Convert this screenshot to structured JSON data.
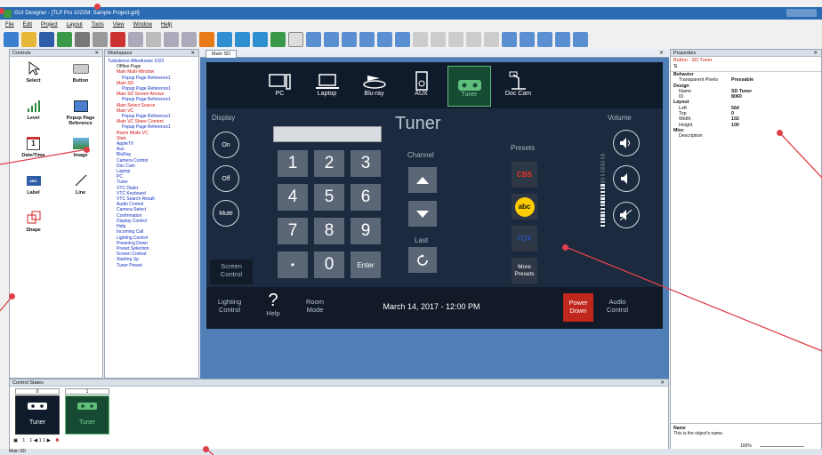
{
  "app": {
    "title": "GUI Designer - [TLP Pro 1022M: Sample Project.gdl]"
  },
  "menu": [
    "File",
    "Edit",
    "Project",
    "Layout",
    "Tools",
    "View",
    "Window",
    "Help"
  ],
  "controls_panel": {
    "title": "Controls",
    "items": [
      {
        "label": "Select",
        "icon": "cursor-icon"
      },
      {
        "label": "Button",
        "icon": "button-icon"
      },
      {
        "label": "Level",
        "icon": "level-icon"
      },
      {
        "label": "Popup Page Reference",
        "icon": "popup-page-icon"
      },
      {
        "label": "Date/Time",
        "icon": "calendar-icon"
      },
      {
        "label": "Image",
        "icon": "image-icon"
      },
      {
        "label": "Label",
        "icon": "label-icon"
      },
      {
        "label": "Line",
        "icon": "line-icon"
      },
      {
        "label": "Shape",
        "icon": "shape-icon"
      }
    ]
  },
  "workspace_panel": {
    "title": "Workspace",
    "tree": [
      {
        "text": "Turbulence Afterdusive 1022",
        "c": "blue"
      },
      {
        "text": "Offline Page",
        "c": "k"
      },
      {
        "text": "Main Multi-Window",
        "c": "red"
      },
      {
        "text": "Popup Page Reference1",
        "c": "blue"
      },
      {
        "text": "Main SD",
        "c": "red"
      },
      {
        "text": "Popup Page Reference1",
        "c": "blue"
      },
      {
        "text": "Main SD Screen Arrows",
        "c": "red"
      },
      {
        "text": "Popup Page Reference1",
        "c": "blue"
      },
      {
        "text": "Main Select Source",
        "c": "red"
      },
      {
        "text": "Main VC",
        "c": "red"
      },
      {
        "text": "Popup Page Reference1",
        "c": "blue"
      },
      {
        "text": "Main VC Share Content",
        "c": "red"
      },
      {
        "text": "Popup Page Reference1",
        "c": "blue"
      },
      {
        "text": "Room Mode VC",
        "c": "red"
      },
      {
        "text": "Start",
        "c": "red"
      },
      {
        "text": "AppleTV",
        "c": "blue"
      },
      {
        "text": "Aux",
        "c": "blue"
      },
      {
        "text": "BluRay",
        "c": "blue"
      },
      {
        "text": "Camera Control",
        "c": "blue"
      },
      {
        "text": "Doc Cam",
        "c": "blue"
      },
      {
        "text": "Laptop",
        "c": "blue"
      },
      {
        "text": "PC",
        "c": "blue"
      },
      {
        "text": "Tuner",
        "c": "blue"
      },
      {
        "text": "VTC Dialer",
        "c": "blue"
      },
      {
        "text": "VTC Keyboard",
        "c": "blue"
      },
      {
        "text": "VTC Search Result",
        "c": "blue"
      },
      {
        "text": "Audio Control",
        "c": "blue"
      },
      {
        "text": "Camera Select",
        "c": "blue"
      },
      {
        "text": "Confirmation",
        "c": "blue"
      },
      {
        "text": "Display Control",
        "c": "blue"
      },
      {
        "text": "Help",
        "c": "blue"
      },
      {
        "text": "Incoming Call",
        "c": "blue"
      },
      {
        "text": "Lighting Control",
        "c": "blue"
      },
      {
        "text": "Powering Down",
        "c": "blue"
      },
      {
        "text": "Preset Selection",
        "c": "blue"
      },
      {
        "text": "Screen Control",
        "c": "blue"
      },
      {
        "text": "Starting Up",
        "c": "blue"
      },
      {
        "text": "Tuner Preset",
        "c": "blue"
      }
    ]
  },
  "main_tab": {
    "label": "Main SD"
  },
  "touch_panel": {
    "sources": [
      {
        "label": "PC",
        "icon": "pc-icon"
      },
      {
        "label": "Laptop",
        "icon": "laptop-icon"
      },
      {
        "label": "Blu-ray",
        "icon": "bluray-icon"
      },
      {
        "label": "AUX",
        "icon": "aux-icon"
      },
      {
        "label": "Tuner",
        "icon": "tuner-icon",
        "selected": true
      },
      {
        "label": "Doc Cam",
        "icon": "doc-cam-icon"
      }
    ],
    "display_label": "Display",
    "display_buttons": [
      "On",
      "Off",
      "Mute"
    ],
    "title": "Tuner",
    "keypad": [
      "1",
      "2",
      "3",
      "4",
      "5",
      "6",
      "7",
      "8",
      "9",
      "•",
      "0",
      "Enter"
    ],
    "channel_label": "Channel",
    "last_label": "Last",
    "presets_label": "Presets",
    "preset_logos": [
      "CBS",
      "abc",
      "FOX"
    ],
    "more_presets": "More Presets",
    "volume_label": "Volume",
    "screen_control": "Screen Control",
    "bottom": {
      "lighting": "Lighting Control",
      "help": "Help",
      "room_mode": "Room Mode",
      "datetime": "March 14, 2017 - 12:00 PM",
      "power": "Power Down",
      "audio": "Audio Control"
    }
  },
  "properties_panel": {
    "title": "Properties",
    "subtitle": "Button : SD Tuner",
    "rows": [
      {
        "k": "Behavior",
        "v": "",
        "cat": true
      },
      {
        "k": "Transparent Pixels",
        "v": "Pressable"
      },
      {
        "k": "Design",
        "v": "",
        "cat": true
      },
      {
        "k": "Name",
        "v": "SD Tuner"
      },
      {
        "k": "ID",
        "v": "8060"
      },
      {
        "k": "Layout",
        "v": "",
        "cat": true
      },
      {
        "k": "Left",
        "v": "564"
      },
      {
        "k": "Top",
        "v": "0"
      },
      {
        "k": "Width",
        "v": "102"
      },
      {
        "k": "Height",
        "v": "100"
      },
      {
        "k": "Misc",
        "v": "",
        "cat": true
      },
      {
        "k": "Description",
        "v": ""
      }
    ],
    "help_title": "Name",
    "help_text": "This is the object's name.",
    "zoom": "100%"
  },
  "control_states": {
    "title": "Control States",
    "states": [
      {
        "index": "0",
        "label": "Tuner"
      },
      {
        "index": "1",
        "label": "Tuner"
      }
    ],
    "footer": "1",
    "page_nav": "1 ◀ 1 1 ▶"
  },
  "status": {
    "left": "Main SD"
  },
  "colors": {
    "accent": "#2b6bb4",
    "panel_bg": "#1b2a3e",
    "selected": "#5fbf7b",
    "annotation": "#e0404a"
  }
}
